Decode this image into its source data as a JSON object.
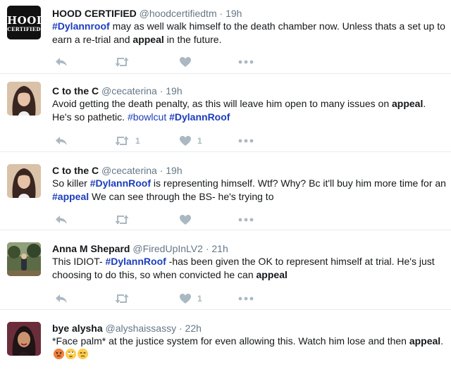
{
  "tweets": [
    {
      "name": "HOOD CERTIFIED",
      "handle": "@hoodcertifiedtm",
      "sep": "·",
      "time": "19h",
      "avatar_text_top": "HOOD",
      "avatar_text_bottom": "CERTIFIED",
      "text": {
        "hashtag1": "#Dylannroof",
        "t1": " may as well walk himself to the death chamber now. Unless thats a set up to earn a re-trial and ",
        "kw": "appeal",
        "t2": " in the future."
      },
      "retweets": "",
      "likes": ""
    },
    {
      "name": "C to the C",
      "handle": "@cecaterina",
      "sep": "·",
      "time": "19h",
      "text": {
        "t1": "Avoid getting the death penalty, as this will leave him open to many issues on ",
        "kw": "appeal",
        "t2": ". He's so pathetic. ",
        "hashtag1": "#bowlcut",
        "t3": " ",
        "hashtag2": "#DylannRoof"
      },
      "retweets": "1",
      "likes": "1"
    },
    {
      "name": "C to the C",
      "handle": "@cecaterina",
      "sep": "·",
      "time": "19h",
      "text": {
        "t1": "So killer ",
        "hashtag1": "#DylannRoof",
        "t2": " is representing himself. Wtf? Why? Bc it'll buy him more time for an ",
        "hashtag2": "#appeal",
        "t3": " We can see through the BS- he's trying to"
      },
      "retweets": "",
      "likes": ""
    },
    {
      "name": "Anna M Shepard",
      "handle": "@FiredUpInLV2",
      "sep": "·",
      "time": "21h",
      "text": {
        "t1": "This IDIOT- ",
        "hashtag1": "#DylannRoof",
        "t2": " -has been given the OK to represent himself at trial. He's just choosing to do this, so when convicted he can ",
        "kw": "appeal"
      },
      "retweets": "",
      "likes": "1"
    },
    {
      "name": "bye alysha",
      "handle": "@alyshaissassy",
      "sep": "·",
      "time": "22h",
      "text": {
        "t1": "*Face palm* at the justice system for even allowing this. Watch him lose and then ",
        "kw": "appeal",
        "t2": ". "
      },
      "emojis": [
        "angry-face-emoji",
        "eye-roll-emoji",
        "unamused-face-emoji"
      ]
    }
  ],
  "colors": {
    "hashtag": "#1b3dbb",
    "meta": "#657786",
    "icon": "#aab8c2",
    "divider": "#e6ecf0"
  }
}
